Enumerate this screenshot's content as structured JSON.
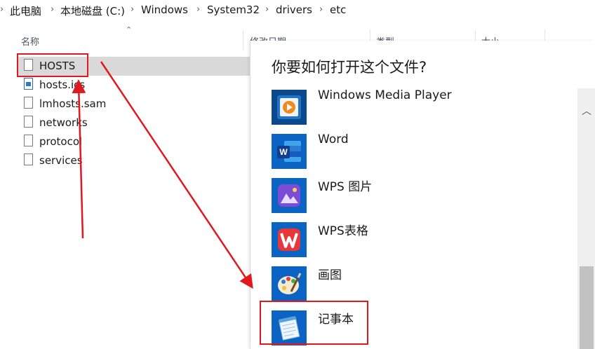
{
  "breadcrumb": {
    "items": [
      "此电脑",
      "本地磁盘 (C:)",
      "Windows",
      "System32",
      "drivers",
      "etc"
    ],
    "separator": "›"
  },
  "columns": {
    "name": "名称",
    "modified": "修改日期",
    "type": "类型",
    "size": "大小"
  },
  "files": [
    {
      "name": "HOSTS",
      "icon": "file-icon",
      "selected": true
    },
    {
      "name": "hosts.ics",
      "icon": "ics-file-icon",
      "selected": false
    },
    {
      "name": "lmhosts.sam",
      "icon": "file-icon",
      "selected": false
    },
    {
      "name": "networks",
      "icon": "file-icon",
      "selected": false
    },
    {
      "name": "protocol",
      "icon": "file-icon",
      "selected": false
    },
    {
      "name": "services",
      "icon": "file-icon",
      "selected": false
    }
  ],
  "dialog": {
    "title": "你要如何打开这个文件?",
    "apps": [
      {
        "name": "Windows Media Player",
        "icon": "media-player-icon"
      },
      {
        "name": "Word",
        "icon": "word-icon"
      },
      {
        "name": "WPS 图片",
        "icon": "wps-picture-icon"
      },
      {
        "name": "WPS表格",
        "icon": "wps-spreadsheet-icon"
      },
      {
        "name": "画图",
        "icon": "paint-icon"
      },
      {
        "name": "记事本",
        "icon": "notepad-icon"
      }
    ]
  },
  "colors": {
    "accent": "#0b63c4",
    "annotation": "#e0191f",
    "selection": "#d9d9d9"
  }
}
